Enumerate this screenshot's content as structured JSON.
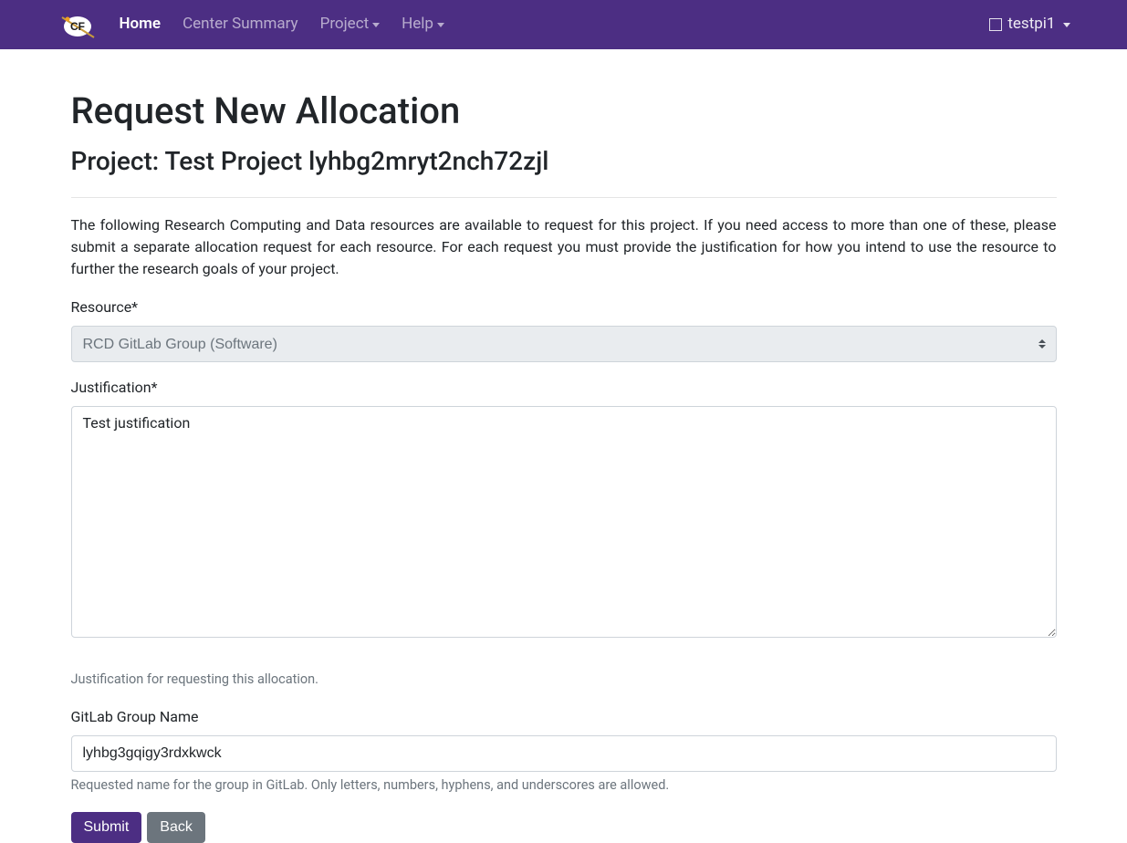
{
  "nav": {
    "home": "Home",
    "center_summary": "Center Summary",
    "project": "Project",
    "help": "Help",
    "user": "testpi1"
  },
  "page": {
    "title": "Request New Allocation",
    "project_prefix": "Project: ",
    "project_name": "Test Project lyhbg2mryt2nch72zjl",
    "description": "The following Research Computing and Data resources are available to request for this project. If you need access to more than one of these, please submit a separate allocation request for each resource. For each request you must provide the justification for how you intend to use the resource to further the research goals of your project."
  },
  "form": {
    "resource": {
      "label": "Resource*",
      "selected": "RCD GitLab Group (Software)"
    },
    "justification": {
      "label": "Justification*",
      "value": "Test justification",
      "help": "Justification for requesting this allocation."
    },
    "gitlab_group": {
      "label": "GitLab Group Name",
      "value": "lyhbg3gqigy3rdxkwck",
      "help": "Requested name for the group in GitLab. Only letters, numbers, hyphens, and underscores are allowed."
    },
    "submit_label": "Submit",
    "back_label": "Back"
  }
}
